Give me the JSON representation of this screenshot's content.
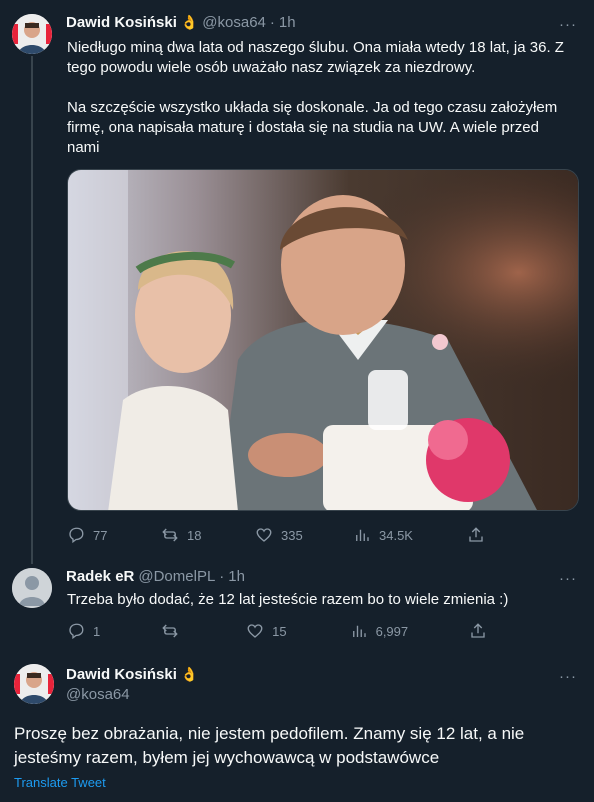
{
  "tweet1": {
    "author_name": "Dawid Kosiński",
    "handle": "@kosa64",
    "separator": "·",
    "time": "1h",
    "verified_emoji": "👌",
    "more_label": "···",
    "text_p1": "Niedługo miną dwa lata od naszego ślubu. Ona miała wtedy 18 lat, ja 36. Z tego powodu wiele osób uważało nasz związek za niezdrowy.",
    "text_p2": "Na szczęście wszystko układa się doskonale. Ja od tego czasu założyłem firmę, ona napisała maturę i dostała się na studia na UW. A wiele przed nami",
    "replies": "77",
    "retweets": "18",
    "likes": "335",
    "views": "34.5K"
  },
  "tweet2": {
    "author_name": "Radek eR",
    "handle": "@DomelPL",
    "separator": "·",
    "time": "1h",
    "more_label": "···",
    "text": "Trzeba było dodać, że 12 lat jesteście razem bo to wiele zmienia :)",
    "replies": "1",
    "retweets": "",
    "likes": "15",
    "views": "6,997"
  },
  "tweet3": {
    "author_name": "Dawid Kosiński",
    "handle": "@kosa64",
    "verified_emoji": "👌",
    "more_label": "···",
    "text": "Proszę bez obrażania, nie jestem pedofilem. Znamy się 12 lat, a nie jesteśmy razem, byłem jej wychowawcą w podstawówce",
    "translate_label": "Translate Tweet"
  },
  "colors": {
    "background": "#15202b",
    "text": "#f7f9f9",
    "secondary": "#8b98a5",
    "link": "#1d9bf0",
    "border": "#38444d"
  }
}
